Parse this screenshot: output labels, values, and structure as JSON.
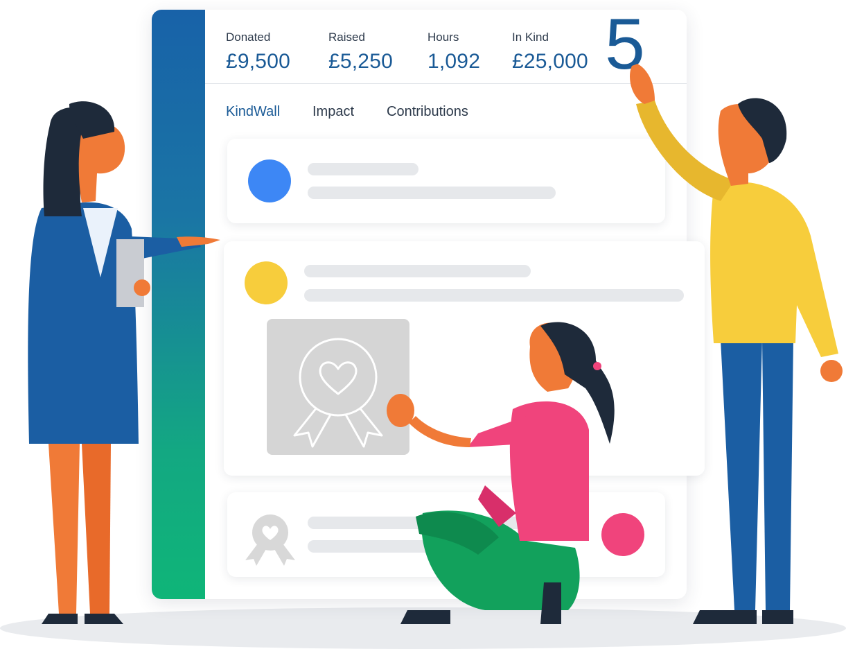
{
  "stats": [
    {
      "label": "Donated",
      "value": "£9,500"
    },
    {
      "label": "Raised",
      "value": "£5,250"
    },
    {
      "label": "Hours",
      "value": "1,092"
    },
    {
      "label": "In Kind",
      "value": "£25,000"
    }
  ],
  "tabs": [
    {
      "label": "KindWall",
      "active": true
    },
    {
      "label": "Impact",
      "active": false
    },
    {
      "label": "Contributions",
      "active": false
    }
  ],
  "big_number": "5",
  "colors": {
    "sidebar_top": "#1862a8",
    "sidebar_bottom": "#0fb578",
    "accent_text": "#1a5a96",
    "card1_avatar": "#3d87f5",
    "card2_avatar": "#f7cd3c",
    "card3_avatar": "#f0447c"
  },
  "icons": [
    "award-heart-icon",
    "award-heart-small-icon"
  ]
}
